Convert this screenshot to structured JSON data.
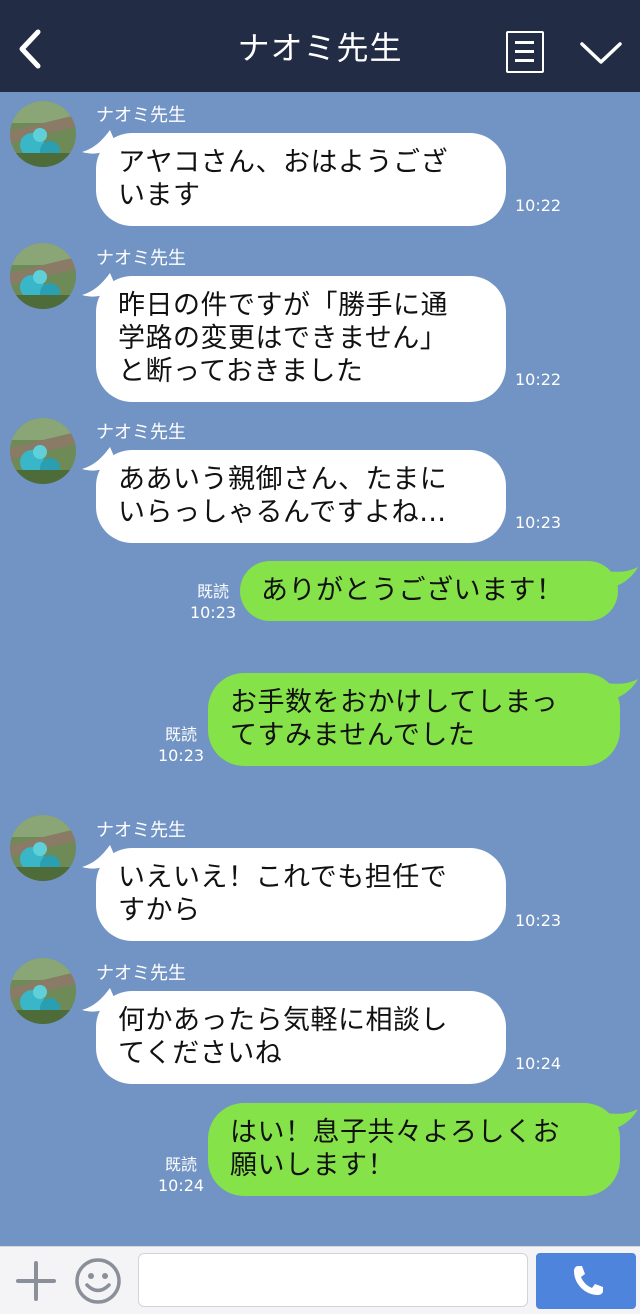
{
  "header": {
    "title": "ナオミ先生",
    "back_icon": "chevron-left-icon",
    "menu_icon": "menu-list-icon",
    "collapse_icon": "chevron-down-icon"
  },
  "colors": {
    "header_bg": "#222c44",
    "chat_bg": "#7294c4",
    "bubble_left": "#ffffff",
    "bubble_right": "#85e249",
    "send_button": "#4e84dc"
  },
  "messages": [
    {
      "side": "left",
      "sender": "ナオミ先生",
      "text": "アヤコさん、おはようござ\nいます",
      "time": "10:22"
    },
    {
      "side": "left",
      "sender": "ナオミ先生",
      "text": "昨日の件ですが「勝手に通\n学路の変更はできません」\nと断っておきました",
      "time": "10:22"
    },
    {
      "side": "left",
      "sender": "ナオミ先生",
      "text": "ああいう親御さん、たまに\nいらっしゃるんですよね…",
      "time": "10:23"
    },
    {
      "side": "right",
      "read": "既読",
      "text": "ありがとうございます！",
      "time": "10:23"
    },
    {
      "side": "right",
      "read": "既読",
      "text": "お手数をおかけしてしまっ\nてすみませんでした",
      "time": "10:23"
    },
    {
      "side": "left",
      "sender": "ナオミ先生",
      "text": "いえいえ！これでも担任で\nすから",
      "time": "10:23"
    },
    {
      "side": "left",
      "sender": "ナオミ先生",
      "text": "何かあったら気軽に相談し\nてくださいね",
      "time": "10:24"
    },
    {
      "side": "right",
      "read": "既読",
      "text": "はい！息子共々よろしくお\n願いします！",
      "time": "10:24"
    }
  ],
  "input": {
    "placeholder": "",
    "value": "",
    "plus_icon": "plus-icon",
    "emoji_icon": "smiley-icon",
    "call_icon": "phone-icon"
  }
}
